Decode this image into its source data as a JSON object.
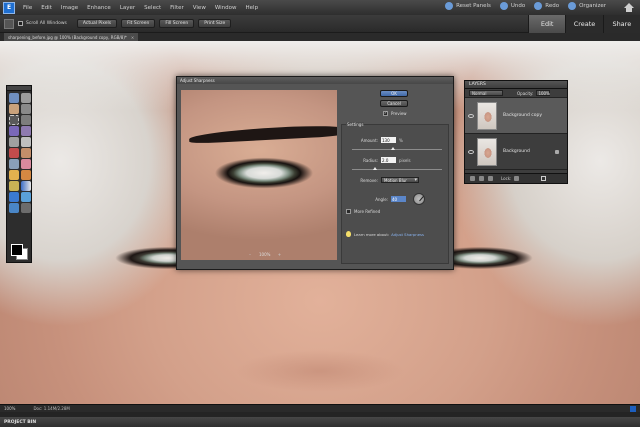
{
  "menubar": {
    "items": [
      "File",
      "Edit",
      "Image",
      "Enhance",
      "Layer",
      "Select",
      "Filter",
      "View",
      "Window",
      "Help"
    ],
    "right": {
      "reset": "Reset Panels",
      "undo": "Undo",
      "redo": "Redo",
      "organizer": "Organizer"
    }
  },
  "optbar": {
    "scroll": "Scroll All Windows",
    "buttons": [
      "Actual Pixels",
      "Fit Screen",
      "Fill Screen",
      "Print Size"
    ]
  },
  "modes": [
    "Edit",
    "Create",
    "Share"
  ],
  "doc": {
    "tab_label": "sharpening_before.jpg @ 100% (Background copy, RGB/8)*",
    "close": "×"
  },
  "dialog": {
    "title": "Adjust Sharpness",
    "ok": "OK",
    "cancel": "Cancel",
    "preview": "Preview",
    "settings_title": "Settings",
    "amount_label": "Amount:",
    "amount_value": "130",
    "amount_unit": "%",
    "amount_fraction": 0.45,
    "radius_label": "Radius:",
    "radius_value": "2.0",
    "radius_unit": "pixels",
    "radius_fraction": 0.25,
    "remove_label": "Remove:",
    "remove_value": "Motion Blur",
    "angle_label": "Angle:",
    "angle_value": "40",
    "more_refined": "More Refined",
    "tip": "Learn more about:",
    "tip_link": "Adjust Sharpness",
    "zoom": "100%",
    "zoom_minus": "–",
    "zoom_plus": "+"
  },
  "layers": {
    "title": "LAYERS",
    "blend": "Normal",
    "opacity_label": "Opacity:",
    "opacity_value": "100%",
    "rows": [
      {
        "name": "Background copy"
      },
      {
        "name": "Background"
      }
    ],
    "lock_label": "Lock:"
  },
  "status": {
    "zoom": "100%",
    "info": "Doc: 1.14M/2.28M"
  },
  "project_bin": "PROJECT BIN"
}
